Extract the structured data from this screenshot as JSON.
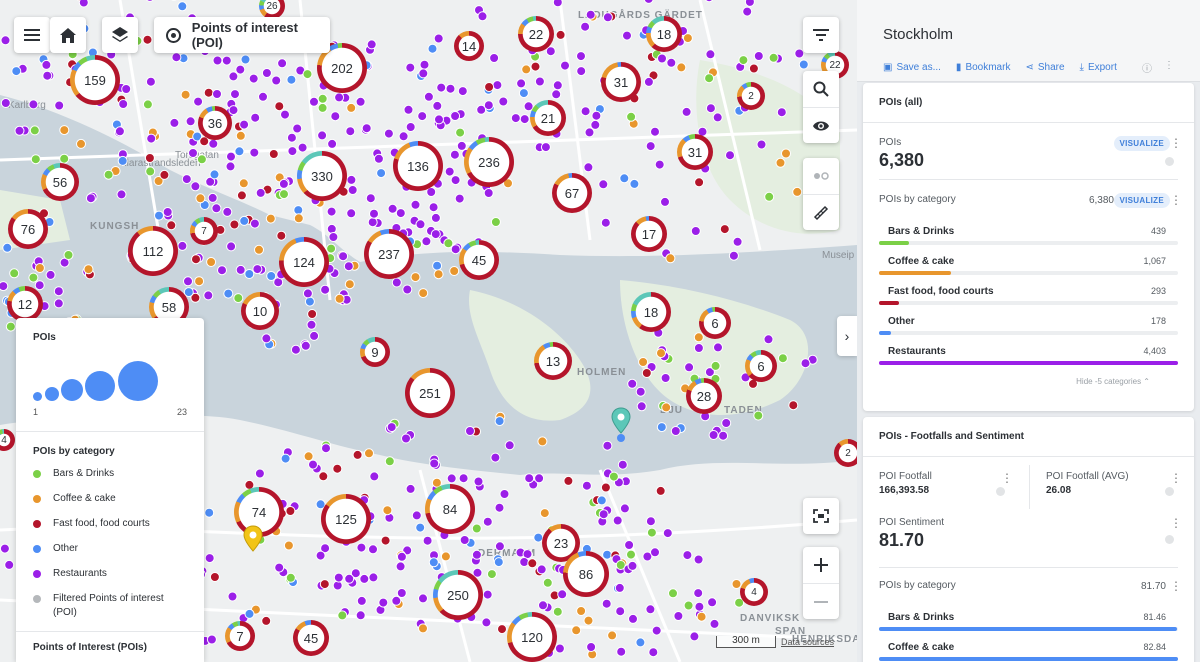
{
  "toolbar": {
    "menu_icon": "hamburger-icon",
    "home_icon": "home-icon",
    "layers_icon": "layers-icon",
    "layer_label": "Points of interest (POI)"
  },
  "map": {
    "labels": [
      "KUNGSH",
      "HOLMEN",
      "DJU",
      "TADEN",
      "DANVIKSK",
      "SPAN",
      "HENRIKSDAL",
      "DERMALM",
      "Museip",
      "Karlberg",
      "Klarastrandsleden",
      "Torsgatan",
      "LADUGÅRDS GÄRDET"
    ],
    "clusters": [
      "26",
      "202",
      "159",
      "36",
      "56",
      "76",
      "7",
      "112",
      "124",
      "330",
      "136",
      "236",
      "237",
      "45",
      "14",
      "22",
      "18",
      "31",
      "21",
      "67",
      "31",
      "17",
      "2",
      "22",
      "12",
      "58",
      "10",
      "9",
      "251",
      "13",
      "18",
      "6",
      "6",
      "28",
      "74",
      "125",
      "84",
      "23",
      "86",
      "250",
      "4",
      "7",
      "45",
      "120",
      "2",
      "4"
    ],
    "scale": "300 m",
    "attribution": "Data sources"
  },
  "legend": {
    "pois_title": "POIs",
    "range_min": "1",
    "range_max": "23",
    "category_title": "POIs by category",
    "categories": [
      {
        "label": "Bars & Drinks",
        "color": "#7bd047"
      },
      {
        "label": "Coffee & cake",
        "color": "#e8962d"
      },
      {
        "label": "Fast food, food courts",
        "color": "#b4152b"
      },
      {
        "label": "Other",
        "color": "#4e8df5"
      },
      {
        "label": "Restaurants",
        "color": "#9b1fe8"
      },
      {
        "label": "Filtered Points of interest (POI)",
        "color": "#b5b8bb"
      }
    ],
    "bottom_title": "Points of Interest (POIs)"
  },
  "sidebar": {
    "title": "Stockholm",
    "actions": {
      "save": "Save as...",
      "bookmark": "Bookmark",
      "share": "Share",
      "export": "Export"
    },
    "card1": {
      "title": "POIs (all)",
      "pois_label": "POIs",
      "pois_value": "6,380",
      "visualize": "VISUALIZE",
      "bycat_label": "POIs by category",
      "bycat_total": "6,380",
      "categories": [
        {
          "name": "Bars & Drinks",
          "value": "439",
          "color": "#7bd047",
          "frac": 0.1
        },
        {
          "name": "Coffee & cake",
          "value": "1,067",
          "color": "#e8962d",
          "frac": 0.242
        },
        {
          "name": "Fast food, food courts",
          "value": "293",
          "color": "#b4152b",
          "frac": 0.067
        },
        {
          "name": "Other",
          "value": "178",
          "color": "#4e8df5",
          "frac": 0.04
        },
        {
          "name": "Restaurants",
          "value": "4,403",
          "color": "#9b1fe8",
          "frac": 1.0
        }
      ],
      "hide_label": "Hide -5 categories"
    },
    "card2": {
      "title": "POIs - Footfalls and Sentiment",
      "footfall_label": "POI Footfall",
      "footfall_value": "166,393.58",
      "footfall_avg_label": "POI Footfall (AVG)",
      "footfall_avg_value": "26.08",
      "sentiment_label": "POI Sentiment",
      "sentiment_value": "81.70",
      "bycat_label": "POIs by category",
      "bycat_total": "81.70",
      "categories": [
        {
          "name": "Bars & Drinks",
          "value": "81.46",
          "color": "#4e8df5",
          "frac": 0.997
        },
        {
          "name": "Coffee & cake",
          "value": "82.84",
          "color": "#4e8df5",
          "frac": 1.0
        }
      ]
    }
  }
}
